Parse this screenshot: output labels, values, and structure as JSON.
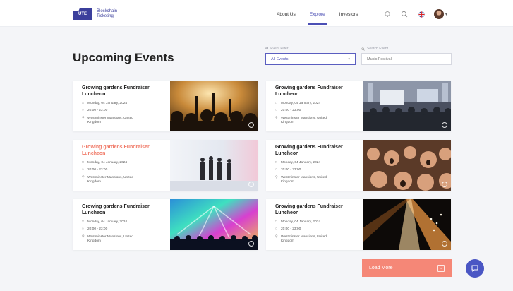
{
  "header": {
    "logo_mark": "UTE",
    "logo_text": "Blockchain Ticketing",
    "nav": [
      "About Us",
      "Explore",
      "Investors"
    ],
    "active_nav": "Explore"
  },
  "page": {
    "title": "Upcoming Events"
  },
  "filters": {
    "event_filter": {
      "label": "Event Filter",
      "value": "All Events"
    },
    "search": {
      "label": "Search Event",
      "placeholder": "Music Festival"
    }
  },
  "events": [
    {
      "title": "Growing gardens Fundraiser Luncheon",
      "date": "Monday, 04 January, 2024",
      "time": "20:00 - 23:00",
      "location": "Westminster Mansions, United Kingdom",
      "image": "concert-crowd-icon",
      "highlighted": false
    },
    {
      "title": "Growing gardens Fundraiser Luncheon",
      "date": "Monday, 04 January, 2024",
      "time": "20:00 - 23:00",
      "location": "Westminster Mansions, United Kingdom",
      "image": "conference-hall-icon",
      "highlighted": false
    },
    {
      "title": "Growing gardens Fundraiser Luncheon",
      "date": "Monday, 04 January, 2024",
      "time": "20:00 - 23:00",
      "location": "Westminster Mansions, United Kingdom",
      "image": "stage-performers-icon",
      "highlighted": true
    },
    {
      "title": "Growing gardens Fundraiser Luncheon",
      "date": "Monday, 04 January, 2024",
      "time": "20:00 - 23:00",
      "location": "Westminster Mansions, United Kingdom",
      "image": "cheering-crowd-icon",
      "highlighted": false
    },
    {
      "title": "Growing gardens Fundraiser Luncheon",
      "date": "Monday, 04 January, 2024",
      "time": "20:00 - 23:00",
      "location": "Westminster Mansions, United Kingdom",
      "image": "festival-lights-icon",
      "highlighted": false
    },
    {
      "title": "Growing gardens Fundraiser Luncheon",
      "date": "Monday, 04 January, 2024",
      "time": "20:00 - 23:00",
      "location": "Westminster Mansions, United Kingdom",
      "image": "spotlight-stage-icon",
      "highlighted": false
    }
  ],
  "actions": {
    "load_more": "Load More"
  },
  "colors": {
    "brand": "#3b3f9c",
    "accent": "#f58777",
    "highlight_title": "#f07a68",
    "chat": "#4a56c4"
  }
}
